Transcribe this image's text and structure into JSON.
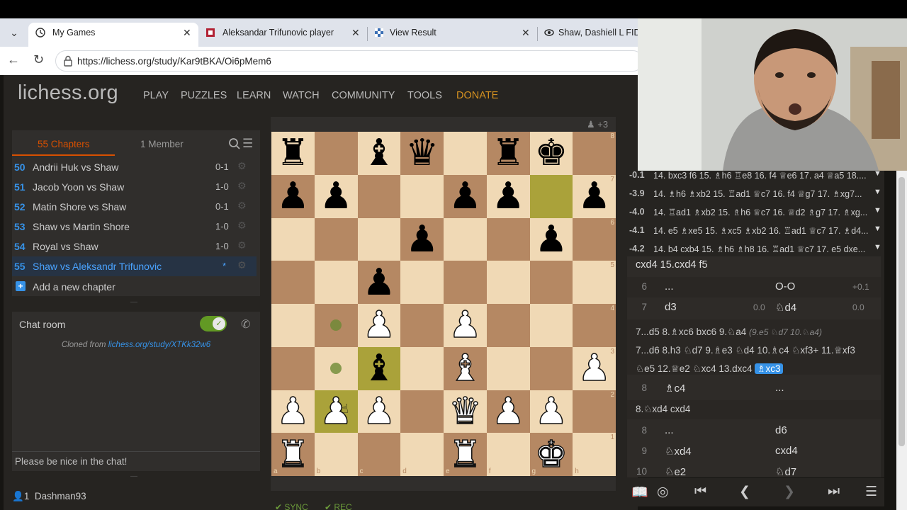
{
  "browser": {
    "tabs": [
      {
        "title": "My Games",
        "active": true
      },
      {
        "title": "Aleksandar Trifunovic player profil",
        "active": false
      },
      {
        "title": "View Result",
        "active": false
      },
      {
        "title": "Shaw, Dashiell L FIDE",
        "active": false
      }
    ],
    "url": "https://lichess.org/study/Kar9tBKA/Oi6pMem6"
  },
  "site": {
    "logo": "lichess.org",
    "nav": [
      "PLAY",
      "PUZZLES",
      "LEARN",
      "WATCH",
      "COMMUNITY",
      "TOOLS",
      "DONATE"
    ]
  },
  "study": {
    "chapters_tab": "55 Chapters",
    "members_tab": "1 Member",
    "chapters": [
      {
        "num": "50",
        "name": "Andrii Huk vs Shaw",
        "result": "0-1"
      },
      {
        "num": "51",
        "name": "Jacob Yoon vs Shaw",
        "result": "1-0"
      },
      {
        "num": "52",
        "name": "Matin Shore vs Shaw",
        "result": "0-1"
      },
      {
        "num": "53",
        "name": "Shaw vs Martin Shore",
        "result": "1-0"
      },
      {
        "num": "54",
        "name": "Royal vs Shaw",
        "result": "1-0"
      },
      {
        "num": "55",
        "name": "Shaw vs Aleksandr Trifunovic",
        "result": "*"
      }
    ],
    "add_chapter": "Add a new chapter"
  },
  "chat": {
    "title": "Chat room",
    "cloned_prefix": "Cloned from ",
    "cloned_link": "lichess.org/study/XTKk32w6",
    "placeholder": "Please be nice in the chat!",
    "member": "Dashman93",
    "member_count": "1"
  },
  "board": {
    "top_counter": "+3",
    "bottom_labels": [
      "SYNC",
      "REC"
    ]
  },
  "engine": {
    "lines": [
      {
        "eval": "-0.1",
        "moves": "14. bxc3 f6 15. ♗h6 ♖e8 16. f4 ♕e6 17. a4 ♕a5 18...."
      },
      {
        "eval": "-3.9",
        "moves": "14. ♗h6 ♗xb2 15. ♖ad1 ♕c7 16. f4 ♕g7 17. ♗xg7..."
      },
      {
        "eval": "-4.0",
        "moves": "14. ♖ad1 ♗xb2 15. ♗h6 ♕c7 16. ♕d2 ♗g7 17. ♗xg..."
      },
      {
        "eval": "-4.1",
        "moves": "14. e5 ♗xe5 15. ♗xc5 ♗xb2 16. ♖ad1 ♕c7 17. ♗d4..."
      },
      {
        "eval": "-4.2",
        "moves": "14. b4 cxb4 15. ♗h6 ♗h8 16. ♖ad1 ♕c7 17. e5 dxe..."
      }
    ]
  },
  "moves": {
    "line_top": "cxd4 15.cxd4 f5",
    "row6": {
      "num": "6",
      "white": "...",
      "black": "O-O",
      "eval_b": "+0.1"
    },
    "row7": {
      "num": "7",
      "white": "d3",
      "eval_w": "0.0",
      "black": "♘d4",
      "eval_b": "0.0"
    },
    "var1_main": "7...d5 8.♗xc6 bxc6 9.♘a4 ",
    "var1_dim": "(9.e5 ♘d7 10.♘a4)",
    "var2_a": "7...d6 8.h3 ♘d7 9.♗e3 ♘d4 10.♗c4 ♘xf3+ 11.♕xf3",
    "var2_b": "♘e5 12.♕e2 ♘xc4 13.dxc4 ",
    "var2_cur": "♗xc3",
    "row8a": {
      "num": "8",
      "white": "♗c4",
      "black": "..."
    },
    "line_mid": "8.♘xd4 cxd4",
    "row8b": {
      "num": "8",
      "white": "...",
      "black": "d6"
    },
    "row9": {
      "num": "9",
      "white": "♘xd4",
      "black": "cxd4"
    },
    "row10": {
      "num": "10",
      "white": "♘e2",
      "black": "♘d7"
    }
  },
  "colors": {
    "accent": "#d85000",
    "link": "#3692e7",
    "donate": "#d59120",
    "highlight": "#aaa23a"
  }
}
